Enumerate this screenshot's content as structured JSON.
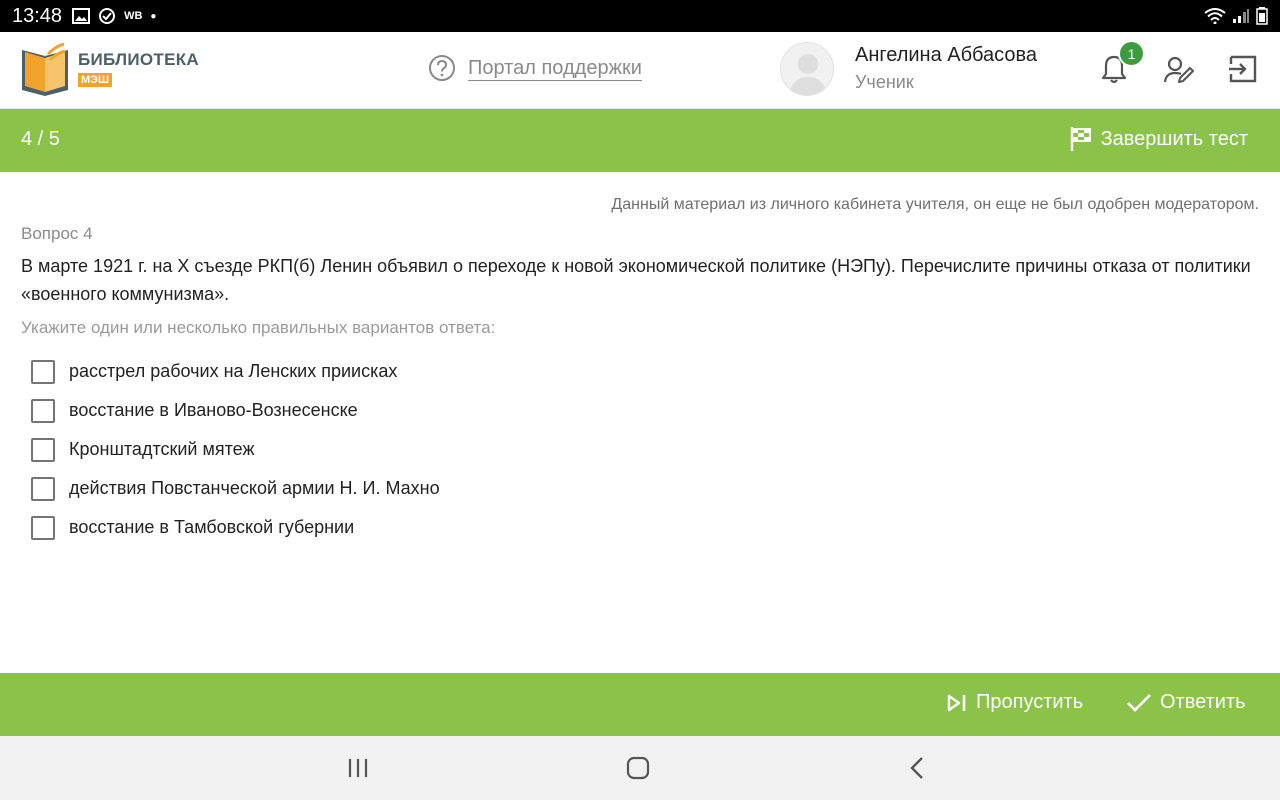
{
  "status_bar": {
    "time": "13:48",
    "carrier_tag": "WB"
  },
  "header": {
    "logo_title": "БИБЛИОТЕКА",
    "logo_sub": "МЭШ",
    "support_label": "Портал поддержки",
    "user_name": "Ангелина Аббасова",
    "user_role": "Ученик",
    "notifications_count": "1"
  },
  "test_bar": {
    "progress": "4 / 5",
    "finish_label": "Завершить тест"
  },
  "question": {
    "notice": "Данный материал из личного кабинета учителя, он еще не был одобрен модератором.",
    "number": "Вопрос 4",
    "text": "В марте 1921 г. на X съезде РКП(б) Ленин объявил о переходе к новой экономической политике (НЭПу). Перечислите причины отказа от политики «военного коммунизма».",
    "hint": "Укажите один или несколько правильных вариантов ответа:",
    "options": [
      {
        "label": "расстрел рабочих на Ленских приисках",
        "checked": false
      },
      {
        "label": "восстание в Иваново-Вознесенске",
        "checked": false
      },
      {
        "label": "Кронштадтский мятеж",
        "checked": false
      },
      {
        "label": "действия Повстанческой армии Н. И. Махно",
        "checked": false
      },
      {
        "label": "восстание в Тамбовской губернии",
        "checked": false
      }
    ]
  },
  "actions": {
    "skip_label": "Пропустить",
    "answer_label": "Ответить"
  },
  "colors": {
    "accent_green": "#8bc34a",
    "badge_green": "#3f9b3f",
    "logo_orange": "#f2a32c"
  },
  "icons": [
    "image-icon",
    "sync-check-icon",
    "wifi-icon",
    "signal-icon",
    "battery-icon",
    "logo-book-icon",
    "help-icon",
    "avatar-icon",
    "bell-icon",
    "edit-user-icon",
    "exit-icon",
    "flag-icon",
    "skip-icon",
    "check-icon",
    "recent-apps-icon",
    "home-icon",
    "back-icon"
  ]
}
